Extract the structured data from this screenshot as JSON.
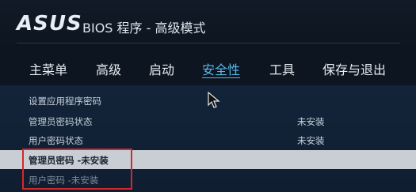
{
  "header": {
    "logo_text": "ASUS",
    "title": "BIOS 程序 - 高级模式"
  },
  "nav": {
    "items": [
      {
        "label": "主菜单"
      },
      {
        "label": "高级"
      },
      {
        "label": "启动"
      },
      {
        "label": "安全性"
      },
      {
        "label": "工具"
      },
      {
        "label": "保存与退出"
      }
    ],
    "active_index": 3
  },
  "security": {
    "rows": [
      {
        "label": "设置应用程序密码",
        "value": ""
      },
      {
        "label": "管理员密码状态",
        "value": "未安装"
      },
      {
        "label": "用户密码状态",
        "value": "未安装"
      },
      {
        "label": "管理员密码 -未安装",
        "value": ""
      },
      {
        "label": "用户密码 -未安装",
        "value": ""
      }
    ]
  },
  "colors": {
    "accent": "#57b7e8",
    "highlight_row": "#c9ced4",
    "annotation_box": "#d92727"
  },
  "icons": {
    "cursor": "mouse-pointer-icon"
  }
}
